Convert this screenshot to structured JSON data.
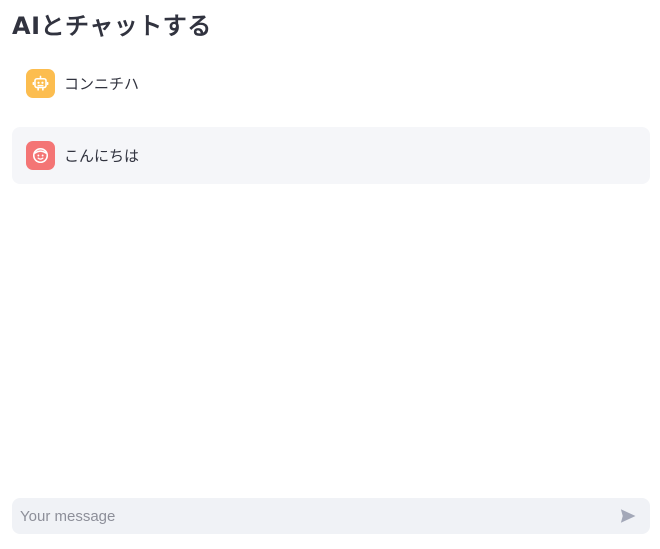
{
  "page": {
    "title": "AIとチャットする"
  },
  "messages": [
    {
      "role": "assistant",
      "avatar_icon": "robot-icon",
      "avatar_color": "#fcbd4f",
      "text": "コンニチハ"
    },
    {
      "role": "user",
      "avatar_icon": "smiley-face-icon",
      "avatar_color": "#f47575",
      "text": "こんにちは"
    }
  ],
  "chat_input": {
    "placeholder": "Your message",
    "value": "",
    "send_icon": "send-arrow-icon"
  },
  "colors": {
    "text": "#31333f",
    "user_bubble_bg": "#f5f6f9",
    "input_bg": "#f0f2f6",
    "send_icon": "#a3a8b8"
  }
}
